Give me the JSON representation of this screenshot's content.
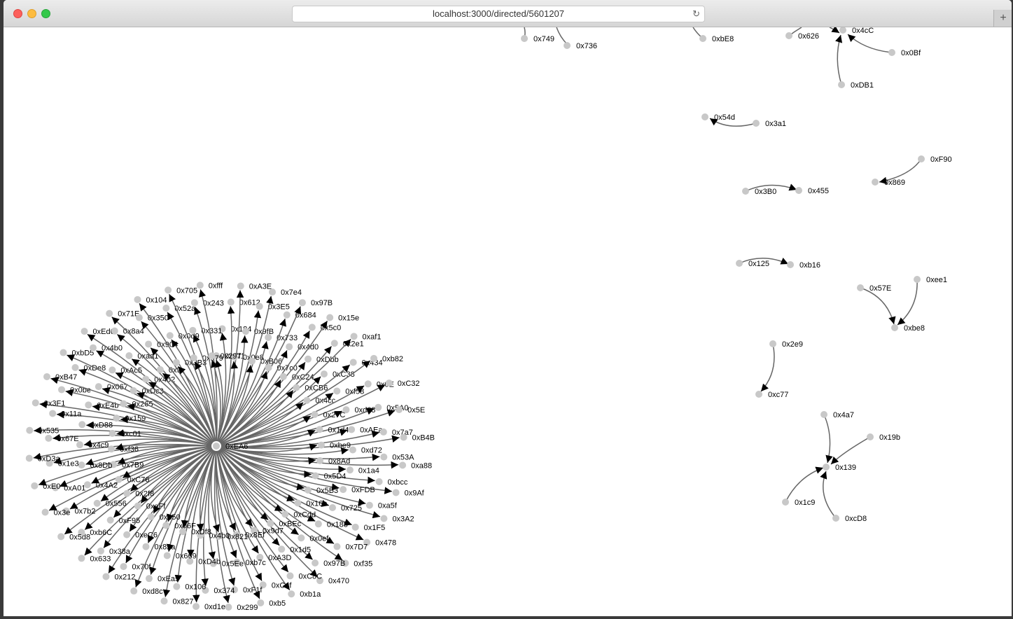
{
  "browser": {
    "url": "localhost:3000/directed/5601207",
    "new_tab_label": "+"
  },
  "graph": {
    "hub": {
      "label": "0xEA6"
    },
    "spokes": [
      "0xCf1",
      "0x184",
      "0x612",
      "0xA3E",
      "0x0e8",
      "0x9fB",
      "0x3E5",
      "0x7e4",
      "0xB06",
      "0x733",
      "0x684",
      "0x97B",
      "0x7c0",
      "0x4d0",
      "0x5c0",
      "0x15e",
      "0xC24",
      "0xDbb",
      "0x2e1",
      "0xaf1",
      "0xCB6",
      "0xC38",
      "0x434",
      "0xb82",
      "0x4cc",
      "0xf58",
      "0x0E",
      "0xC32",
      "0x27C",
      "0xd68",
      "0x5A0",
      "0x5E",
      "0x1d4",
      "0xAEa",
      "0x7a7",
      "0xB4B",
      "0xbe9",
      "0xd72",
      "0x53A",
      "0xa88",
      "0x8Ad",
      "0x1a4",
      "0xbcc",
      "0x9Af",
      "0x5D4",
      "0xFDB",
      "0xa5f",
      "0x3A2",
      "0x5B3",
      "0x725",
      "0x1F5",
      "0x478",
      "0x16e",
      "0x188",
      "0x7D7",
      "0xf35",
      "0xCdd",
      "0x0ef",
      "0x97B",
      "0x470",
      "0xBEc",
      "0x1d5",
      "0xC8C",
      "0xb1a",
      "0x9d7",
      "0xA3D",
      "0xC4f",
      "0xb5",
      "0x8Ef",
      "0xb7c",
      "0xF1f",
      "0x299",
      "0x821",
      "0x5Ee",
      "0x374",
      "0xd1e",
      "0x4b0",
      "0xD4b",
      "0x106",
      "0x827",
      "0xDf8",
      "0x669",
      "0xEa5",
      "0xd8c",
      "0x06F",
      "0x82a",
      "0x70f",
      "0x212",
      "0xb50",
      "0xeC6",
      "0x38a",
      "0x633",
      "0xeFf",
      "0xF95",
      "0xb6C",
      "0x5d8",
      "0x2f8",
      "0x556",
      "0x7b2",
      "0x3e",
      "0xC76",
      "0x4A2",
      "0xA01",
      "0xE0",
      "0x7B9",
      "0x8Db",
      "0x1e3",
      "0xD3a",
      "0xf36",
      "0x4c9",
      "0x67E",
      "0x535",
      "0xc01",
      "0xD88",
      "0x11a",
      "0x3F1",
      "0x159",
      "0xE4b",
      "0x0be",
      "0xB47",
      "0x265",
      "0x067",
      "0xDe8",
      "0xbD5",
      "0xDc3",
      "0xAc5",
      "0x4b0",
      "0xEd6",
      "0x402",
      "0xaa1",
      "0x8a4",
      "0x71E",
      "0x9",
      "0x904",
      "0x350",
      "0x104",
      "0x3B3",
      "0x0d9",
      "0x52a",
      "0x705",
      "0x979",
      "0x331",
      "0x243",
      "0xfff",
      "0x297"
    ],
    "extra_nodes": [
      "0x749",
      "0x736",
      "0xbE8",
      "0x626",
      "0x4cC",
      "0x0Bf",
      "0xDB1",
      "0x54d",
      "0x3a1",
      "0xF90",
      "0x869",
      "0x3B0",
      "0x455",
      "0x125",
      "0xb16",
      "0x57E",
      "0xee1",
      "0xbe8",
      "0x2e9",
      "0xc77",
      "0x4a7",
      "0x19b",
      "0x139",
      "0x1c9",
      "0xcD8"
    ]
  }
}
